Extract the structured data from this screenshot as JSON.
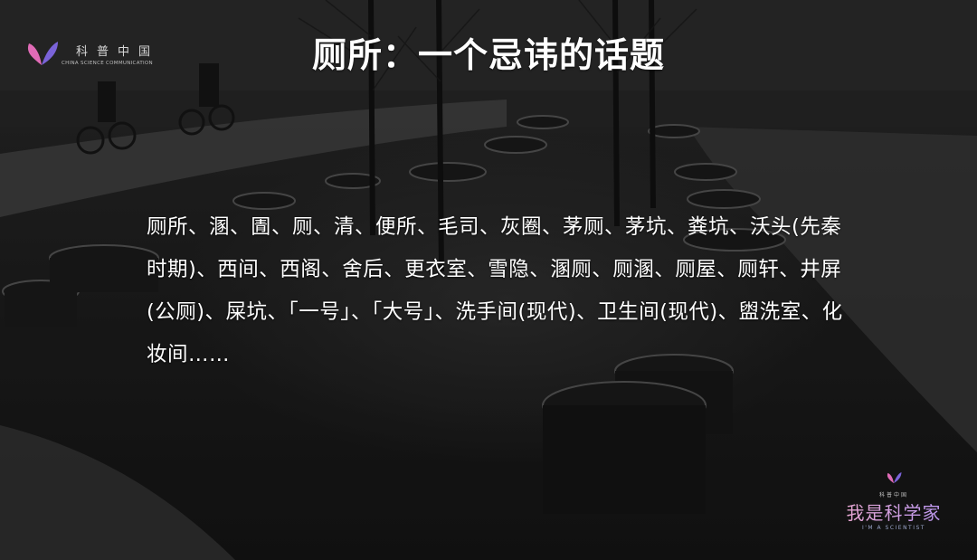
{
  "slide": {
    "title": "厕所：一个忌讳的话题",
    "body": "厕所、溷、圊、厕、清、便所、毛司、灰圈、茅厕、茅坑、粪坑、沃头(先秦时期)、西间、西阁、舍后、更衣室、雪隐、溷厕、厕溷、厕屋、厕轩、井屏(公厕)、屎坑、「一号」、「大号」、洗手间(现代)、卫生间(现代)、盥洗室、化妆间……"
  },
  "logo_top": {
    "cn": "科普中国",
    "en": "CHINA SCIENCE COMMUNICATION"
  },
  "logo_bottom": {
    "small": "科普中国",
    "name": "我是科学家",
    "sub": "I'M A SCIENTIST"
  },
  "colors": {
    "title": "#ffffff",
    "body": "#ffffff",
    "brand_pink": "#e9a7cf",
    "brand_purple": "#b996f2"
  },
  "icons": [
    "butterfly-logo-icon"
  ]
}
